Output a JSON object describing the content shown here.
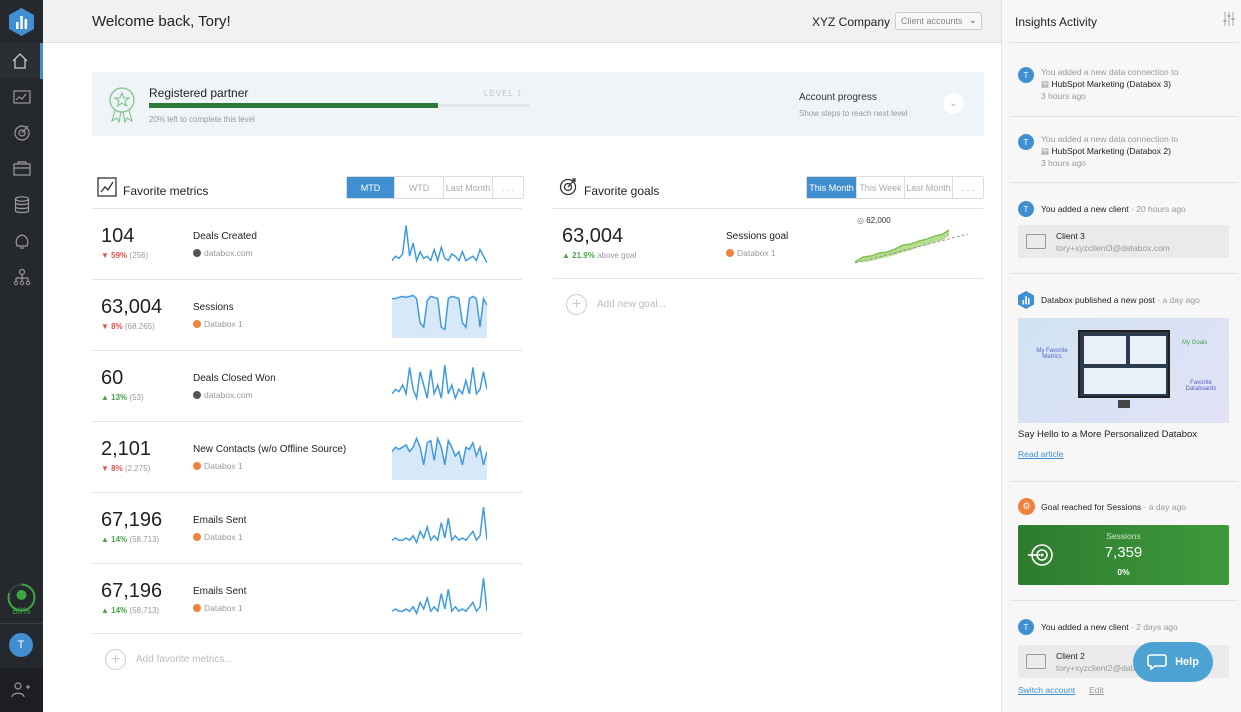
{
  "header": {
    "title": "Welcome back, Tory!",
    "company": "XYZ Company",
    "client_select": "Client accounts"
  },
  "sidebar": {
    "progress_label": "80%",
    "progress_value": 0.8,
    "avatar": "T",
    "nav_icons": [
      "home-icon",
      "dashboard-icon",
      "goals-icon",
      "reports-icon",
      "datasources-icon",
      "alerts-icon",
      "team-icon"
    ]
  },
  "partner": {
    "title": "Registered partner",
    "level": "LEVEL 1",
    "progress": 0.8,
    "subtitle": "20% left to complete this level",
    "progress_title": "Account progress",
    "progress_sub": "Show steps to reach next level"
  },
  "metrics": {
    "title": "Favorite metrics",
    "tabs": [
      "MTD",
      "WTD",
      "Last Month",
      ". . ."
    ],
    "active_tab": "MTD",
    "add_label": "Add favorite metrics...",
    "rows": [
      {
        "value": "104",
        "direction": "down",
        "pct": "59%",
        "prev": "(256)",
        "name": "Deals Created",
        "source": "databox.com",
        "src_type": "dark",
        "spark": [
          0.1,
          0.2,
          0.15,
          0.25,
          0.9,
          0.2,
          0.5,
          0.1,
          0.3,
          0.15,
          0.2,
          0.1,
          0.35,
          0.1,
          0.4,
          0.15,
          0.1,
          0.25,
          0.2,
          0.1,
          0.3,
          0.1,
          0.15,
          0.2,
          0.1,
          0.35,
          0.2,
          0.05
        ]
      },
      {
        "value": "63,004",
        "direction": "down",
        "pct": "8%",
        "prev": "(68,265)",
        "name": "Sessions",
        "source": "Databox 1",
        "src_type": "orange",
        "spark": [
          0.85,
          0.85,
          0.88,
          0.9,
          0.88,
          0.9,
          0.92,
          0.85,
          0.3,
          0.2,
          0.8,
          0.9,
          0.88,
          0.85,
          0.2,
          0.15,
          0.85,
          0.9,
          0.88,
          0.85,
          0.3,
          0.2,
          0.85,
          0.9,
          0.85,
          0.2,
          0.85,
          0.7
        ],
        "filled": true
      },
      {
        "value": "60",
        "direction": "up",
        "pct": "13%",
        "prev": "(53)",
        "name": "Deals Closed Won",
        "source": "databox.com",
        "src_type": "dark",
        "spark": [
          0.3,
          0.4,
          0.35,
          0.5,
          0.3,
          0.9,
          0.4,
          0.2,
          0.8,
          0.5,
          0.2,
          0.85,
          0.3,
          0.5,
          0.2,
          0.95,
          0.3,
          0.5,
          0.2,
          0.4,
          0.3,
          0.6,
          0.3,
          0.9,
          0.3,
          0.4,
          0.8,
          0.4
        ]
      },
      {
        "value": "2,101",
        "direction": "down",
        "pct": "8%",
        "prev": "(2,275)",
        "name": "New Contacts (w/o Offline Source)",
        "source": "Databox 1",
        "src_type": "orange",
        "spark": [
          0.6,
          0.7,
          0.65,
          0.7,
          0.75,
          0.6,
          0.7,
          0.9,
          0.7,
          0.3,
          0.8,
          0.85,
          0.4,
          0.9,
          0.7,
          0.3,
          0.85,
          0.7,
          0.5,
          0.6,
          0.3,
          0.7,
          0.65,
          0.8,
          0.5,
          0.7,
          0.3,
          0.6
        ],
        "filled": true
      },
      {
        "value": "67,196",
        "direction": "up",
        "pct": "14%",
        "prev": "(58,713)",
        "name": "Emails Sent",
        "source": "Databox 1",
        "src_type": "orange",
        "spark": [
          0.2,
          0.25,
          0.2,
          0.2,
          0.25,
          0.2,
          0.3,
          0.15,
          0.4,
          0.25,
          0.5,
          0.2,
          0.3,
          0.2,
          0.6,
          0.25,
          0.7,
          0.2,
          0.3,
          0.2,
          0.25,
          0.2,
          0.3,
          0.4,
          0.2,
          0.3,
          0.95,
          0.2
        ]
      },
      {
        "value": "67,196",
        "direction": "up",
        "pct": "14%",
        "prev": "(58,713)",
        "name": "Emails Sent",
        "source": "Databox 1",
        "src_type": "orange",
        "spark": [
          0.2,
          0.25,
          0.2,
          0.2,
          0.25,
          0.2,
          0.3,
          0.15,
          0.4,
          0.25,
          0.5,
          0.2,
          0.3,
          0.2,
          0.6,
          0.25,
          0.7,
          0.2,
          0.3,
          0.2,
          0.25,
          0.2,
          0.3,
          0.4,
          0.2,
          0.3,
          0.95,
          0.2
        ]
      }
    ]
  },
  "goals": {
    "title": "Favorite goals",
    "tabs": [
      "This Month",
      "This Week",
      "Last Month",
      ". . ."
    ],
    "active_tab": "This Month",
    "add_label": "Add new goal...",
    "goal": {
      "value": "63,004",
      "pct": "21.9%",
      "note": "above goal",
      "name": "Sessions goal",
      "source": "Databox 1",
      "target": "62,000"
    }
  },
  "panel": {
    "title": "Insights Activity",
    "activities": [
      {
        "avatar": "T",
        "text": "You added a new data connection to",
        "detail": "HubSpot Marketing (Databox 3)",
        "time": "3 hours ago"
      },
      {
        "avatar": "T",
        "text": "You added a new data connection to",
        "detail": "HubSpot Marketing (Databox 2)",
        "time": "3 hours ago"
      },
      {
        "avatar": "T",
        "text": "You added a new client",
        "time": "· 20 hours ago",
        "client": {
          "name": "Client 3",
          "email": "tory+xyzclient3@databox.com"
        }
      },
      {
        "text": "Databox published a new post",
        "time": "· a day ago",
        "post_title": "Say Hello to a More Personalized Databox",
        "link": "Read article",
        "image_labels": [
          "My Favorite Metrics",
          "My Goals",
          "Favorite Databoards"
        ]
      },
      {
        "text": "Goal reached for Sessions",
        "time": "· a day ago",
        "goal_name": "Sessions",
        "goal_value": "7,359",
        "goal_pct": "0%"
      },
      {
        "avatar": "T",
        "text": "You added a new client",
        "time": "· 2 days ago",
        "client": {
          "name": "Client 2",
          "email": "tory+xyzclient2@databox.com"
        },
        "links": [
          "Switch account",
          "Edit"
        ]
      }
    ]
  },
  "help": {
    "label": "Help"
  }
}
